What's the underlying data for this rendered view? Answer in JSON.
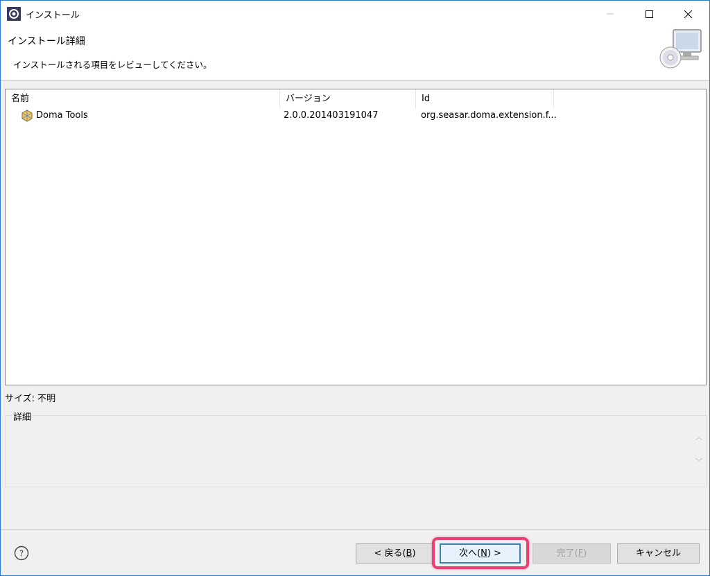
{
  "window": {
    "title": "インストール"
  },
  "header": {
    "title": "インストール詳細",
    "description": "インストールされる項目をレビューしてください。"
  },
  "table": {
    "columns": [
      "名前",
      "バージョン",
      "Id"
    ],
    "rows": [
      {
        "name": "Doma Tools",
        "version": "2.0.0.201403191047",
        "id": "org.seasar.doma.extension.f..."
      }
    ]
  },
  "size_label": "サイズ: 不明",
  "details": {
    "label": "詳細"
  },
  "buttons": {
    "back_prefix": "< 戻る(",
    "back_key": "B",
    "back_suffix": ")",
    "next_prefix": "次へ(",
    "next_key": "N",
    "next_suffix": ") >",
    "finish_prefix": "完了(",
    "finish_key": "F",
    "finish_suffix": ")",
    "cancel": "キャンセル"
  },
  "colors": {
    "highlight": "#ee3c74",
    "window_border": "#2b79d6"
  }
}
